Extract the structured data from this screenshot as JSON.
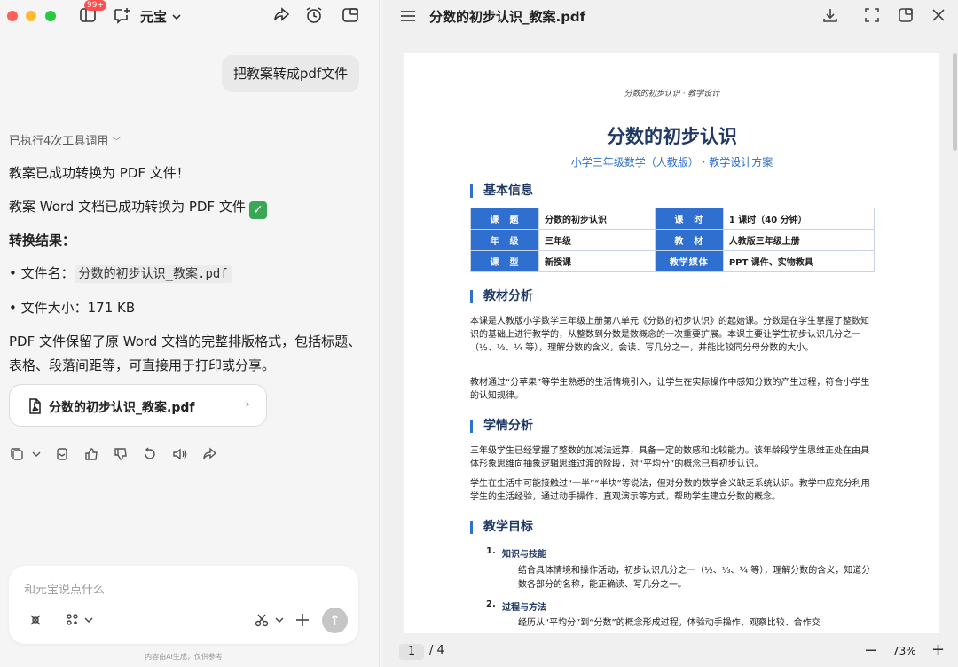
{
  "window": {
    "app_name": "元宝",
    "badge": "99+"
  },
  "chat": {
    "user_message": "把教案转成pdf文件",
    "tool_calls_label": "已执行4次工具调用",
    "reply_line1": "教案已成功转换为 PDF 文件！",
    "reply_line2": "教案 Word 文档已成功转换为 PDF 文件",
    "result_heading": "转换结果：",
    "file_name_label": "• 文件名：",
    "file_name_value": "分数的初步认识_教案.pdf",
    "file_size": "• 文件大小：171 KB",
    "summary": "PDF 文件保留了原 Word 文档的完整排版格式，包括标题、表格、段落间距等，可直接用于打印或分享。",
    "file_card_name": "分数的初步认识_教案.pdf",
    "composer_placeholder": "和元宝说点什么",
    "disclaimer": "内容由AI生成，仅供参考"
  },
  "viewer": {
    "title": "分数的初步认识_教案.pdf",
    "page_current": "1",
    "page_total": "/ 4",
    "zoom": "73%"
  },
  "document": {
    "header": "分数的初步认识 · 教学设计",
    "title": "分数的初步认识",
    "subtitle": "小学三年级数学（人教版） · 教学设计方案",
    "sec_basic": "基本信息",
    "table": {
      "r1": [
        "课　题",
        "分数的初步认识",
        "课　时",
        "1 课时（40 分钟）"
      ],
      "r2": [
        "年　级",
        "三年级",
        "教　材",
        "人教版三年级上册"
      ],
      "r3": [
        "课　型",
        "新授课",
        "教学媒体",
        "PPT 课件、实物教具"
      ]
    },
    "sec_material": "教材分析",
    "material_p1": "本课是人教版小学数学三年级上册第八单元《分数的初步认识》的起始课。分数是在学生掌握了整数知识的基础上进行教学的，从整数到分数是数概念的一次重要扩展。本课主要让学生初步认识几分之一（½、⅓、¼ 等），理解分数的含义，会读、写几分之一，并能比较同分母分数的大小。",
    "material_p2": "教材通过“分苹果”等学生熟悉的生活情境引入，让学生在实际操作中感知分数的产生过程，符合小学生的认知规律。",
    "sec_student": "学情分析",
    "student_p1": "三年级学生已经掌握了整数的加减法运算，具备一定的数感和比较能力。该年龄段学生思维正处在由具体形象思维向抽象逻辑思维过渡的阶段，对“平均分”的概念已有初步认识。",
    "student_p2": "学生在生活中可能接触过“一半”“半块”等说法，但对分数的数学含义缺乏系统认识。教学中应充分利用学生的生活经验，通过动手操作、直观演示等方式，帮助学生建立分数的概念。",
    "sec_goal": "教学目标",
    "goal1_num": "1.",
    "goal1_title": "知识与技能",
    "goal1_text": "结合具体情境和操作活动，初步认识几分之一（½、⅓、¼ 等），理解分数的含义，知道分数各部分的名称，能正确读、写几分之一。",
    "goal2_num": "2.",
    "goal2_title": "过程与方法",
    "goal2_text": "经历从“平均分”到“分数”的概念形成过程，体验动手操作、观察比较、合作交"
  },
  "colors": {
    "accent_blue": "#2e6fd0",
    "title_navy": "#1f3864",
    "check_green": "#3aa757"
  }
}
